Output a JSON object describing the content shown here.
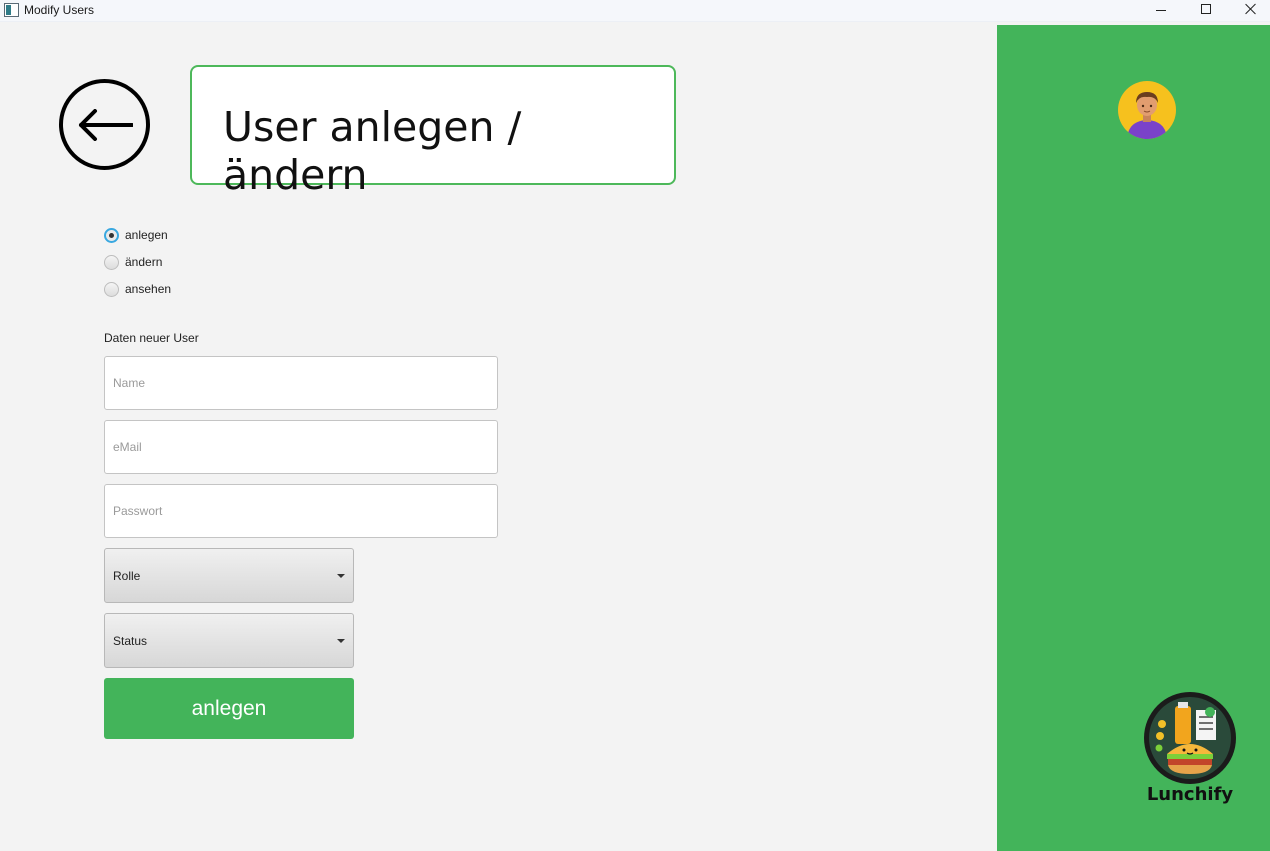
{
  "window": {
    "title": "Modify Users",
    "controls": [
      "minimize-icon",
      "maximize-icon",
      "close-icon"
    ]
  },
  "header": {
    "back_icon": "arrow-left-icon",
    "title": "User anlegen / ändern"
  },
  "mode": {
    "options": [
      {
        "label": "anlegen",
        "checked": true
      },
      {
        "label": "ändern",
        "checked": false
      },
      {
        "label": "ansehen",
        "checked": false
      }
    ]
  },
  "form": {
    "section_label": "Daten neuer User",
    "name_placeholder": "Name",
    "email_placeholder": "eMail",
    "password_placeholder": "Passwort",
    "role_label": "Rolle",
    "status_label": "Status",
    "submit_label": "anlegen"
  },
  "sidebar": {
    "avatar_icon": "user-avatar-icon",
    "logo_text": "Lunchify"
  },
  "colors": {
    "accent": "#43b45a",
    "heading_border": "#4db85a",
    "radio_focus": "#39a8e0"
  }
}
